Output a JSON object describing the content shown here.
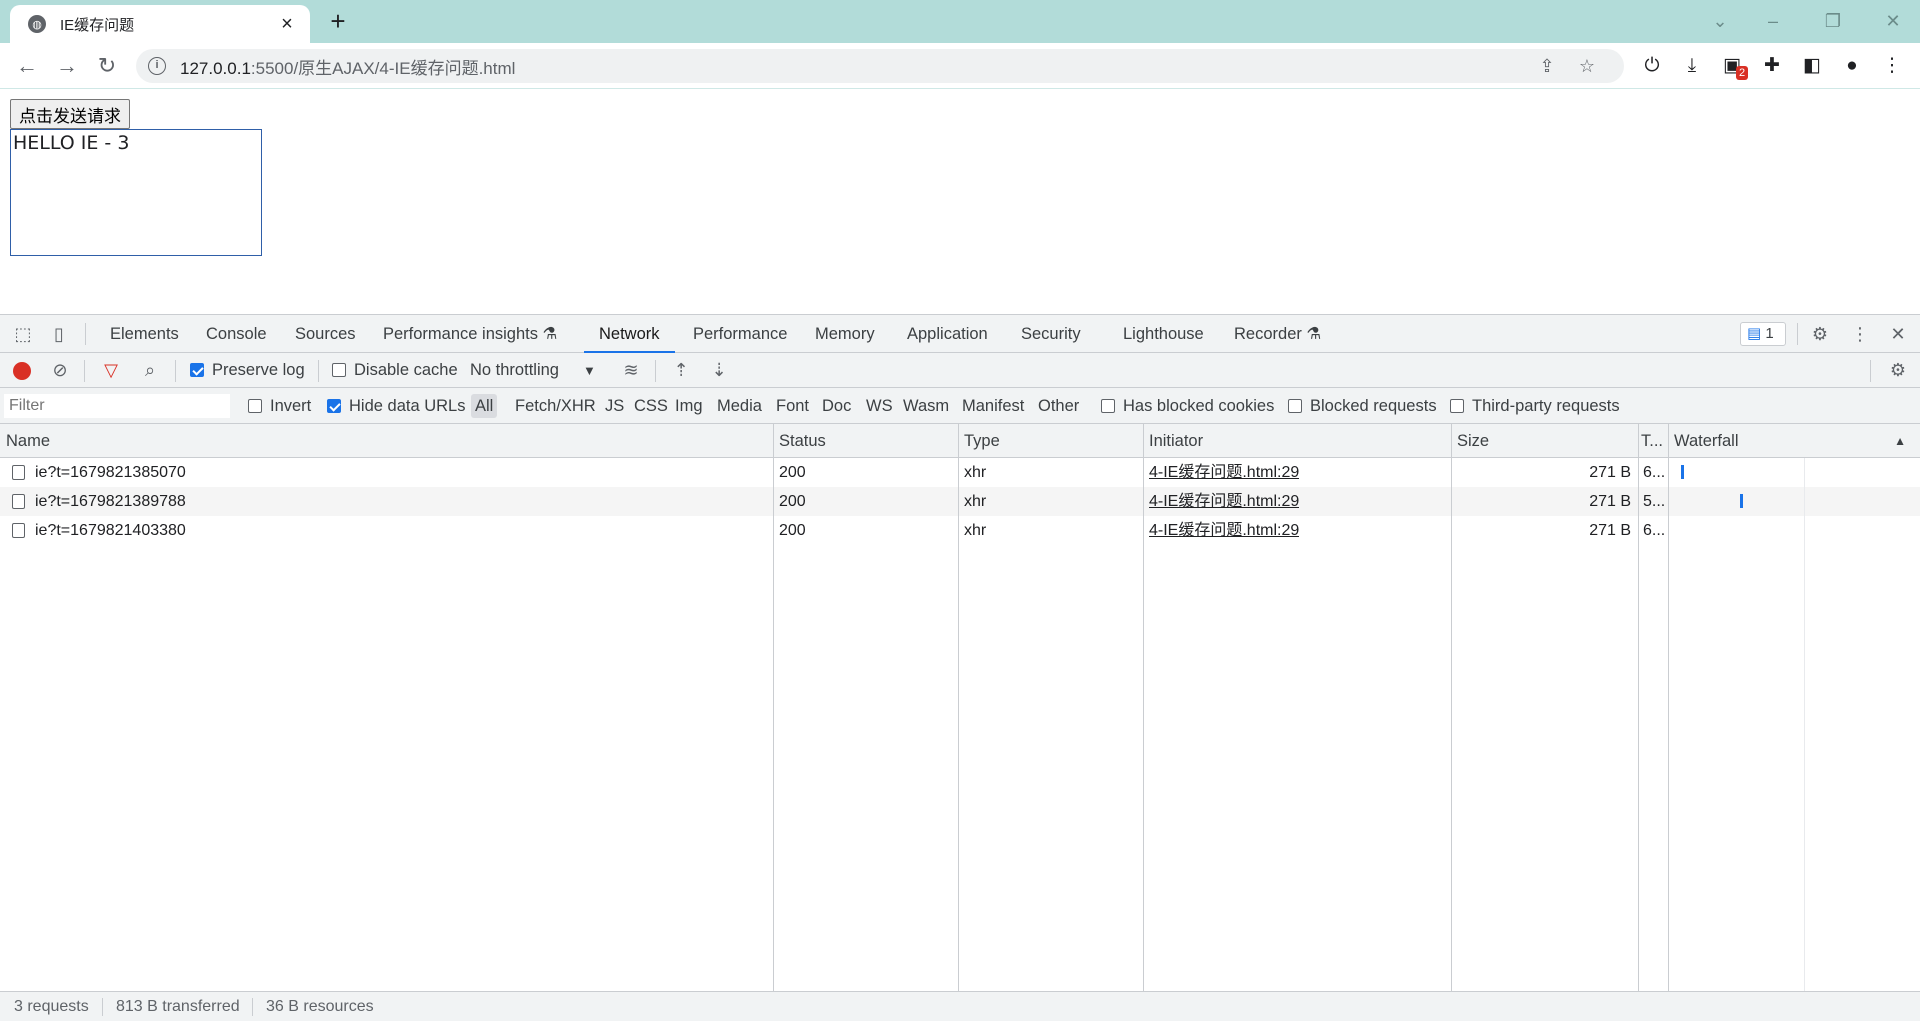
{
  "browser": {
    "tab_title": "IE缓存问题",
    "url_host": "127.0.0.1",
    "url_rest": ":5500/原生AJAX/4-IE缓存问题.html",
    "extension_badge": "2"
  },
  "page": {
    "button_label": "点击发送请求",
    "result_text": "HELLO IE - 3"
  },
  "devtools": {
    "tabs": [
      "Elements",
      "Console",
      "Sources",
      "Performance insights",
      "Network",
      "Performance",
      "Memory",
      "Application",
      "Security",
      "Lighthouse",
      "Recorder"
    ],
    "active_tab": "Network",
    "messages_count": "1",
    "toolbar": {
      "preserve_log": "Preserve log",
      "disable_cache": "Disable cache",
      "throttling": "No throttling"
    },
    "filter": {
      "placeholder": "Filter",
      "invert": "Invert",
      "hide_data_urls": "Hide data URLs",
      "types": [
        "All",
        "Fetch/XHR",
        "JS",
        "CSS",
        "Img",
        "Media",
        "Font",
        "Doc",
        "WS",
        "Wasm",
        "Manifest",
        "Other"
      ],
      "has_blocked_cookies": "Has blocked cookies",
      "blocked_requests": "Blocked requests",
      "third_party": "Third-party requests"
    },
    "columns": [
      "Name",
      "Status",
      "Type",
      "Initiator",
      "Size",
      "T...",
      "Waterfall"
    ],
    "requests": [
      {
        "name": "ie?t=1679821385070",
        "status": "200",
        "type": "xhr",
        "initiator": "4-IE缓存问题.html:29",
        "size": "271 B",
        "time": "6..."
      },
      {
        "name": "ie?t=1679821389788",
        "status": "200",
        "type": "xhr",
        "initiator": "4-IE缓存问题.html:29",
        "size": "271 B",
        "time": "5..."
      },
      {
        "name": "ie?t=1679821403380",
        "status": "200",
        "type": "xhr",
        "initiator": "4-IE缓存问题.html:29",
        "size": "271 B",
        "time": "6..."
      }
    ],
    "status": {
      "requests": "3 requests",
      "transferred": "813 B transferred",
      "resources": "36 B resources"
    }
  }
}
